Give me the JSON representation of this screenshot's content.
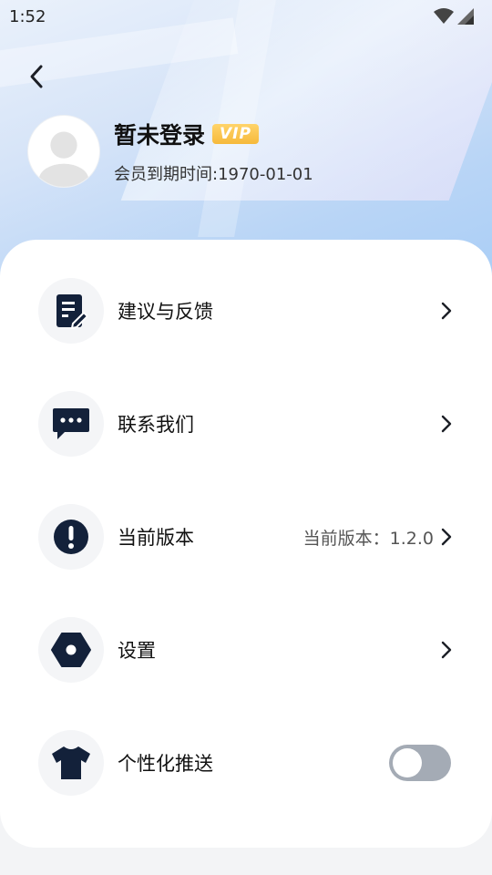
{
  "status_bar": {
    "time": "1:52"
  },
  "profile": {
    "username": "暂未登录",
    "vip_label": "VIP",
    "expiry": "会员到期时间:1970-01-01"
  },
  "menu": {
    "feedback": {
      "label": "建议与反馈",
      "icon": "edit-note-icon"
    },
    "contact": {
      "label": "联系我们",
      "icon": "chat-bubble-icon"
    },
    "version": {
      "label": "当前版本",
      "value": "当前版本：1.2.0",
      "icon": "info-exclamation-icon"
    },
    "settings": {
      "label": "设置",
      "icon": "settings-hexagon-icon"
    },
    "push": {
      "label": "个性化推送",
      "icon": "tshirt-icon",
      "enabled": false
    }
  },
  "colors": {
    "icon_dark": "#13213a",
    "vip_gold": "#f6b93b",
    "toggle_off": "#a4abb5"
  }
}
